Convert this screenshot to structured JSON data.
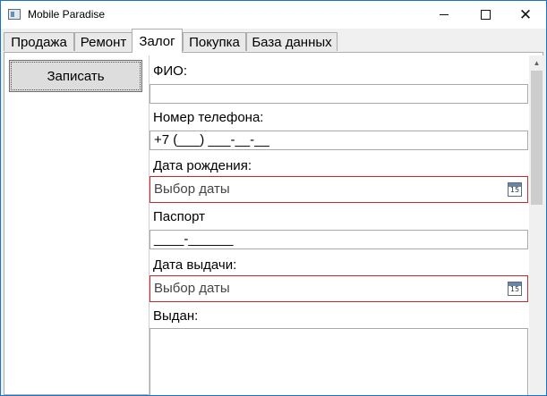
{
  "window": {
    "title": "Mobile Paradise",
    "controls": {
      "minimize": "minimize",
      "maximize": "maximize",
      "close": "✕"
    }
  },
  "tabs": [
    {
      "label": "Продажа",
      "active": false
    },
    {
      "label": "Ремонт",
      "active": false
    },
    {
      "label": "Залог",
      "active": true
    },
    {
      "label": "Покупка",
      "active": false
    },
    {
      "label": "База данных",
      "active": false
    }
  ],
  "actions": {
    "save_label": "Записать"
  },
  "form": {
    "fio_label": "ФИО:",
    "fio_value": "",
    "phone_label": "Номер телефона:",
    "phone_value": "+7 (___) ___-__-__",
    "birth_label": "Дата рождения:",
    "birth_placeholder": "Выбор даты",
    "passport_label": "Паспорт",
    "passport_value": "____-______",
    "issue_date_label": "Дата выдачи:",
    "issue_date_placeholder": "Выбор даты",
    "issued_by_label": "Выдан:",
    "calendar_day": "15"
  },
  "icons": {
    "app": "window-icon",
    "calendar": "calendar-icon",
    "scroll_up": "chevron-up-icon"
  },
  "colors": {
    "invalid_border": "#c62a2a",
    "window_border": "#1a73c6",
    "scroll_thumb": "#cdcdcd"
  }
}
